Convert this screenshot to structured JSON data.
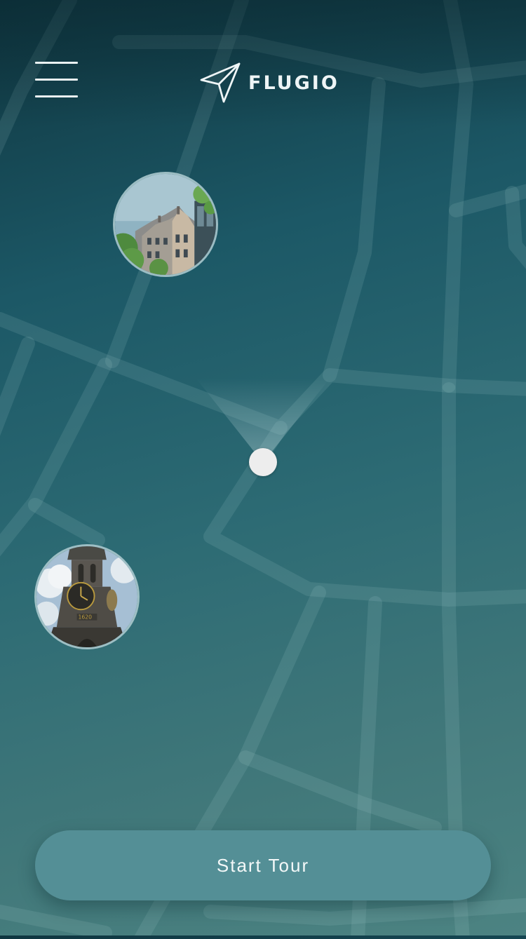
{
  "header": {
    "menu_icon": "hamburger-menu-icon",
    "logo_icon": "paper-plane-icon",
    "brand_name": "FLUGIO"
  },
  "map": {
    "points_of_interest": [
      {
        "icon": "canal-house-photo"
      },
      {
        "icon": "clock-tower-photo"
      }
    ],
    "user_location_icon": "location-dot-icon"
  },
  "footer": {
    "start_label": "Start Tour"
  },
  "colors": {
    "accent_button": "#548f96",
    "background_top": "#0f3640",
    "background_bottom": "#4c8382",
    "foreground": "#eef5f6"
  }
}
